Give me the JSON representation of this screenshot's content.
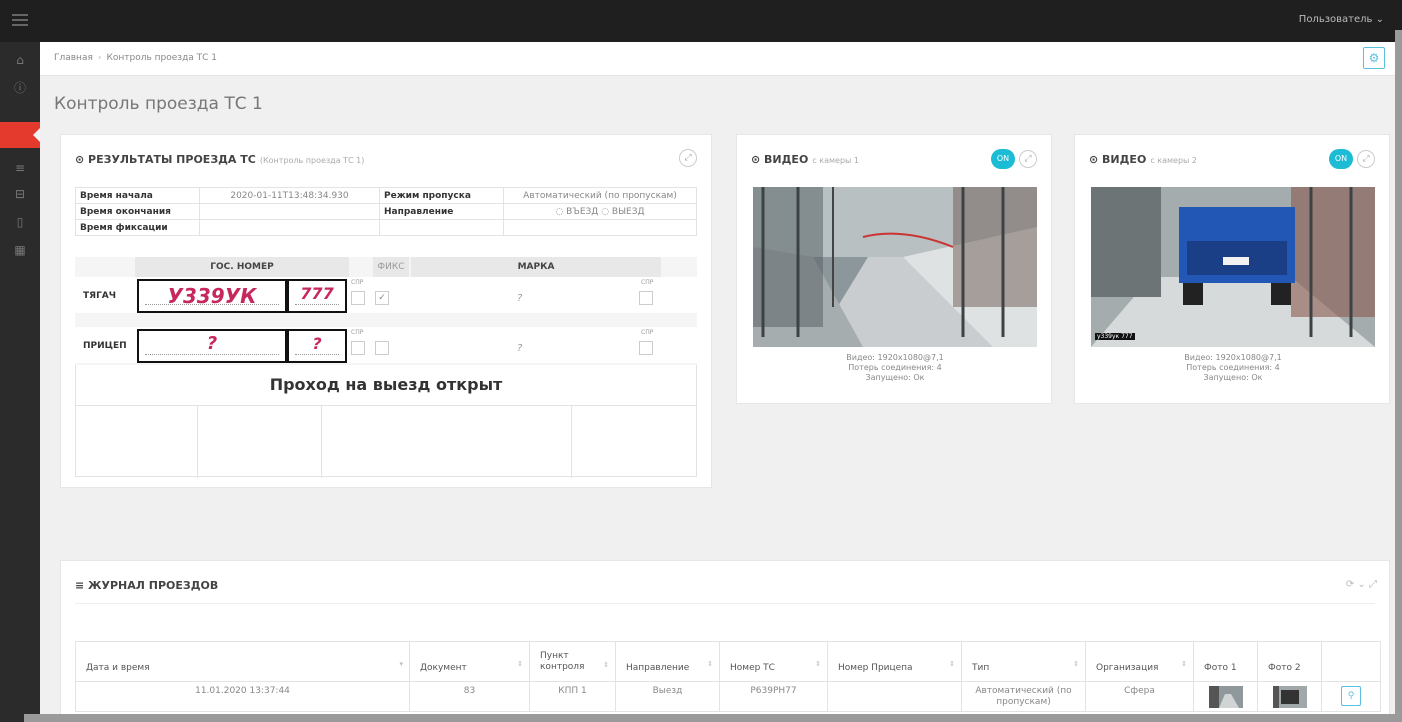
{
  "topbar": {
    "user_label": "Пользователь ⌄"
  },
  "sidebar": {
    "items": [
      {
        "icon": "home-icon",
        "glyph": "⌂"
      },
      {
        "icon": "info-icon",
        "glyph": "ⓘ"
      },
      {
        "icon": "control-icon",
        "glyph": ""
      },
      {
        "icon": "database-icon",
        "glyph": "≡"
      },
      {
        "icon": "print-icon",
        "glyph": "⊟"
      },
      {
        "icon": "document-icon",
        "glyph": "▯"
      },
      {
        "icon": "grid-icon",
        "glyph": "▦"
      }
    ]
  },
  "breadcrumb": {
    "home": "Главная",
    "separator": "›",
    "current": "Контроль проезда ТС 1"
  },
  "page": {
    "title": "Контроль проезда ТС 1"
  },
  "results": {
    "title": "⊙ РЕЗУЛЬТАТЫ ПРОЕЗДА ТС",
    "subtitle": "(Контроль проезда ТС 1)",
    "expand_icon": "⤢",
    "info": {
      "start_label": "Время начала",
      "start_value": "2020-01-11T13:48:34.930",
      "end_label": "Время окончания",
      "fix_label": "Время фиксации",
      "mode_label": "Режим пропуска",
      "mode_value": "Автоматический (по пропускам)",
      "direction_label": "Направление",
      "dir_in": "ВЪЕЗД",
      "dir_out": "ВЫЕЗД"
    },
    "headers": {
      "plate": "ГОС. НОМЕР",
      "fix": "ФИКС",
      "brand": "МАРКА"
    },
    "truck": {
      "label": "ТЯГАЧ",
      "number": "У339УК",
      "region": "777",
      "brand": "?",
      "small": "СПР",
      "fix_checked": "✓"
    },
    "trailer": {
      "label": "ПРИЦЕП",
      "number": "?",
      "region": "?",
      "brand": "?",
      "small": "СПР"
    },
    "status_text": "Проход на выезд открыт"
  },
  "video1": {
    "title": "⊙ ВИДЕО",
    "subtitle": "с камеры 1",
    "on_label": "ON",
    "expand_icon": "⤢",
    "line1": "Видео: 1920x1080@7,1",
    "line2": "Потерь соединения: 4",
    "line3": "Запущено: Ок"
  },
  "video2": {
    "title": "⊙ ВИДЕО",
    "subtitle": "с камеры 2",
    "on_label": "ON",
    "expand_icon": "⤢",
    "overlay_plate": "у339ук 777",
    "line1": "Видео: 1920x1080@7,1",
    "line2": "Потерь соединения: 4",
    "line3": "Запущено: Ок"
  },
  "journal": {
    "title": "≡ ЖУРНАЛ ПРОЕЗДОВ",
    "icons": "⟳ ⌄ ⤢",
    "columns": [
      "Дата и время",
      "Документ",
      "Пункт контроля",
      "Направление",
      "Номер ТС",
      "Номер Прицепа",
      "Тип",
      "Организация",
      "Фото 1",
      "Фото 2",
      ""
    ],
    "rows": [
      {
        "datetime": "11.01.2020 13:37:44",
        "document": "83",
        "checkpoint": "КПП 1",
        "direction": "Выезд",
        "plate": "Р639РН77",
        "trailer": "",
        "type": "Автоматический (по пропускам)",
        "org": "Сфера",
        "view_icon": "⚲"
      }
    ]
  }
}
